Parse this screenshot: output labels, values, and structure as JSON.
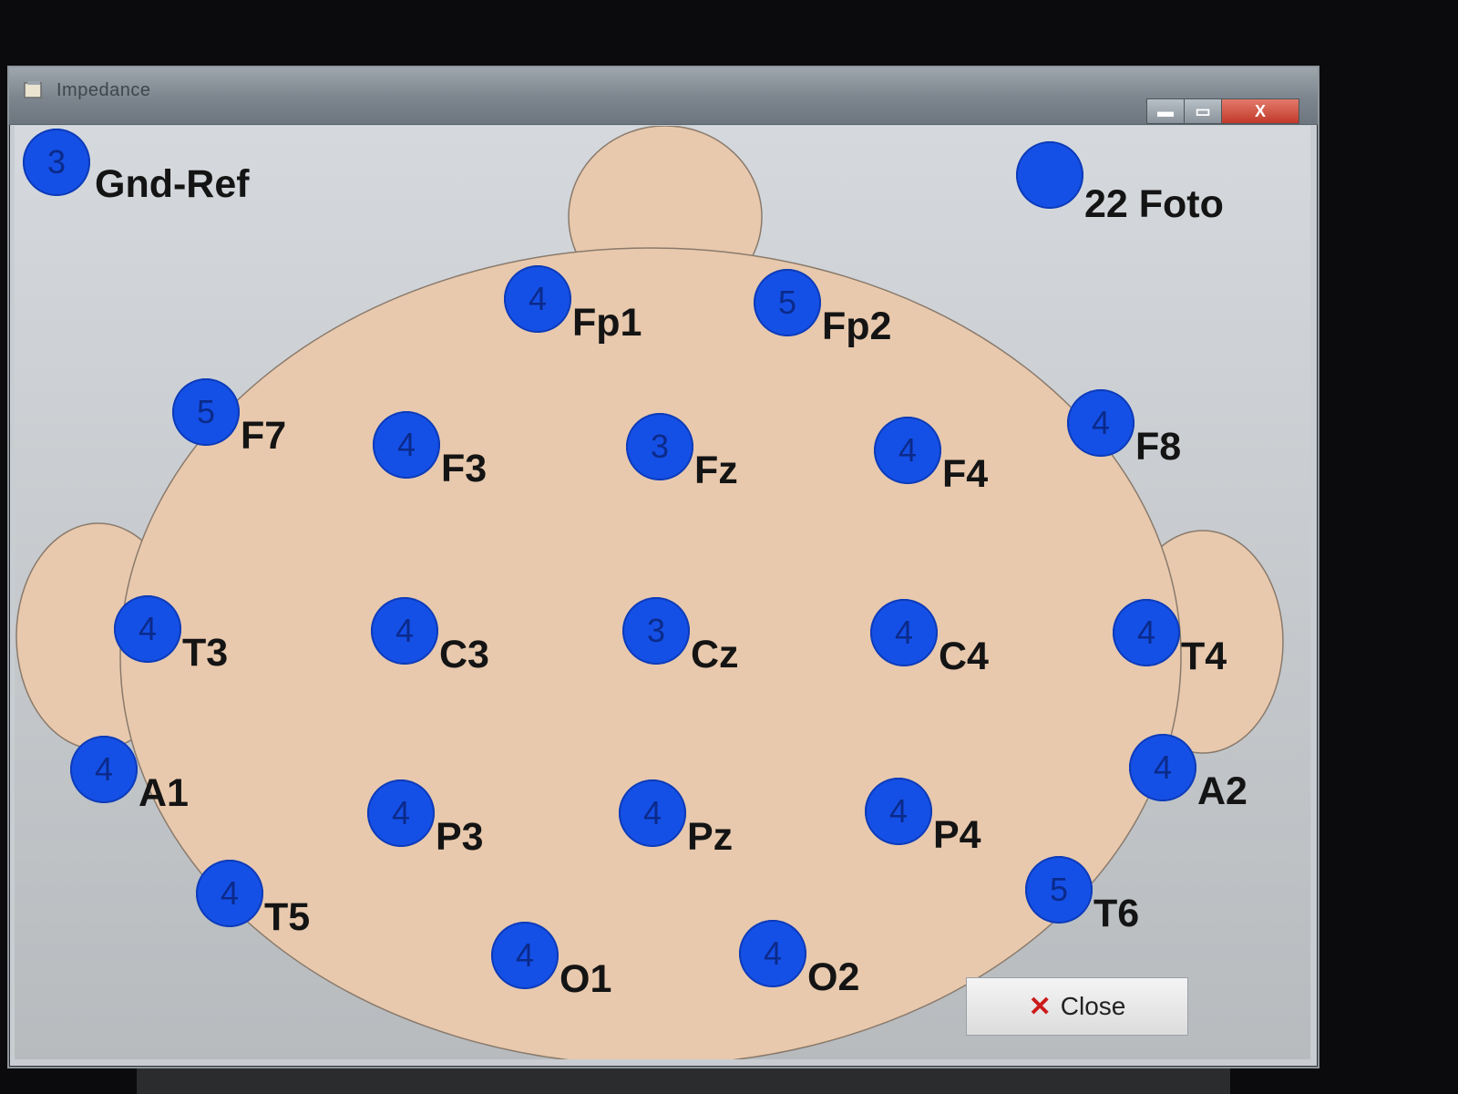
{
  "window": {
    "title": "Impedance"
  },
  "titlebar_buttons": {
    "minimize": "▬",
    "maximize": "▭",
    "close": "X"
  },
  "gnd_ref": {
    "value": "3",
    "label": "Gnd-Ref"
  },
  "foto": {
    "value": "",
    "label": "22 Foto"
  },
  "electrodes": [
    {
      "name": "Fp1",
      "value": "4"
    },
    {
      "name": "Fp2",
      "value": "5"
    },
    {
      "name": "F7",
      "value": "5"
    },
    {
      "name": "F3",
      "value": "4"
    },
    {
      "name": "Fz",
      "value": "3"
    },
    {
      "name": "F4",
      "value": "4"
    },
    {
      "name": "F8",
      "value": "4"
    },
    {
      "name": "T3",
      "value": "4"
    },
    {
      "name": "C3",
      "value": "4"
    },
    {
      "name": "Cz",
      "value": "3"
    },
    {
      "name": "C4",
      "value": "4"
    },
    {
      "name": "T4",
      "value": "4"
    },
    {
      "name": "A1",
      "value": "4"
    },
    {
      "name": "A2",
      "value": "4"
    },
    {
      "name": "P3",
      "value": "4"
    },
    {
      "name": "Pz",
      "value": "4"
    },
    {
      "name": "P4",
      "value": "4"
    },
    {
      "name": "T5",
      "value": "4"
    },
    {
      "name": "T6",
      "value": "5"
    },
    {
      "name": "O1",
      "value": "4"
    },
    {
      "name": "O2",
      "value": "4"
    }
  ],
  "close_button": {
    "icon": "x-icon",
    "label": "Close"
  },
  "colors": {
    "electrode": "#1550e6",
    "scalp": "#e8c9ad",
    "close_icon": "#cc1b1b"
  }
}
